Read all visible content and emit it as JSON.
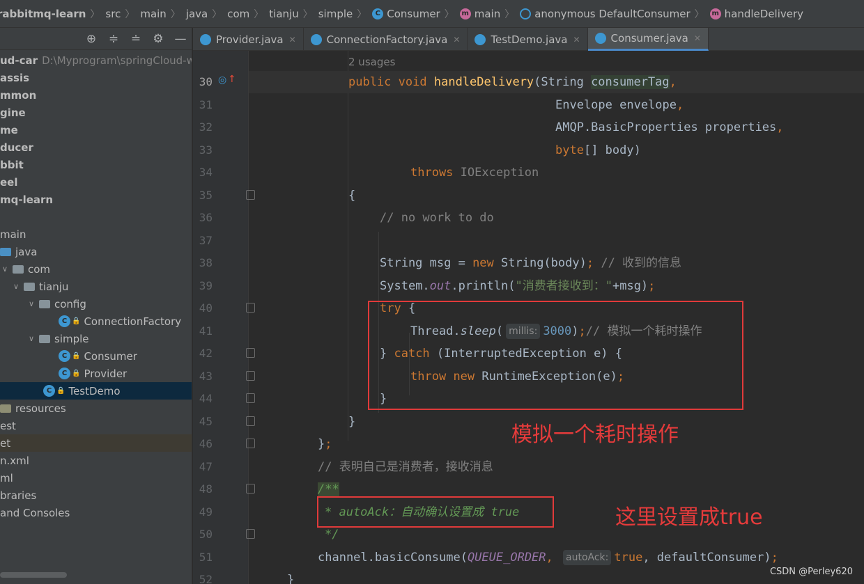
{
  "breadcrumb": {
    "items": [
      "rabbitmq-learn",
      "src",
      "main",
      "java",
      "com",
      "tianju",
      "simple",
      "Consumer",
      "main",
      "anonymous DefaultConsumer",
      "handleDelivery"
    ]
  },
  "tabs": [
    {
      "label": "Provider.java"
    },
    {
      "label": "ConnectionFactory.java"
    },
    {
      "label": "TestDemo.java"
    },
    {
      "label": "Consumer.java"
    }
  ],
  "tree": [
    {
      "label": "ud-car",
      "suffix": "D:\\Myprogram\\springCloud-w"
    },
    {
      "label": "assis"
    },
    {
      "label": "mmon"
    },
    {
      "label": "gine"
    },
    {
      "label": "me"
    },
    {
      "label": "ducer"
    },
    {
      "label": "bbit"
    },
    {
      "label": "eel"
    },
    {
      "label": "mq-learn"
    },
    {
      "label": ""
    },
    {
      "label": "main"
    },
    {
      "label": "java"
    },
    {
      "label": "com"
    },
    {
      "label": "tianju"
    },
    {
      "label": "config"
    },
    {
      "label": "ConnectionFactory"
    },
    {
      "label": "simple"
    },
    {
      "label": "Consumer"
    },
    {
      "label": "Provider"
    },
    {
      "label": "TestDemo"
    },
    {
      "label": "resources"
    },
    {
      "label": "est"
    },
    {
      "label": "et"
    },
    {
      "label": "n.xml"
    },
    {
      "label": "ml"
    },
    {
      "label": "braries"
    },
    {
      "label": "and Consoles"
    }
  ],
  "lines": [
    "30",
    "31",
    "32",
    "33",
    "34",
    "35",
    "36",
    "37",
    "38",
    "39",
    "40",
    "41",
    "42",
    "43",
    "44",
    "45",
    "46",
    "47",
    "48",
    "49",
    "50",
    "51",
    "52"
  ],
  "code": {
    "usages": "2 usages",
    "l30": [
      "public",
      "void",
      "handleDelivery",
      "(String ",
      "consumerTag",
      ","
    ],
    "l31": [
      "Envelope envelope",
      ","
    ],
    "l32": [
      "AMQP.BasicProperties properties",
      ","
    ],
    "l33": [
      "byte",
      "[] body)"
    ],
    "l34": [
      "throws",
      "IOException"
    ],
    "l35": "{",
    "l36": "// no work to do",
    "l38": [
      "String msg = ",
      "new",
      " String(body)",
      ";",
      " // 收到的信息"
    ],
    "l39": [
      "System.",
      "out",
      ".println(",
      "\"消费者接收到：\"",
      "+msg)",
      ";"
    ],
    "l40": [
      "try",
      " {"
    ],
    "l41": [
      "Thread.",
      "sleep",
      "(",
      "millis:",
      "3000",
      ")",
      ";",
      "// 模拟一个耗时操作"
    ],
    "l42": [
      "} ",
      "catch",
      " (InterruptedException e) {"
    ],
    "l43": [
      "throw",
      " ",
      "new",
      " RuntimeException(e)",
      ";"
    ],
    "l44": "}",
    "l45": "}",
    "l46": [
      "}",
      ";"
    ],
    "l47": "// 表明自己是消费者，接收消息",
    "l48": "/**",
    "l49": "* autoAck：自动确认设置成 true",
    "l50": "*/",
    "l51": [
      "channel.basicConsume(",
      "QUEUE_ORDER",
      ", ",
      "autoAck:",
      "true",
      ", defaultConsumer)",
      ";"
    ],
    "l52": "}"
  },
  "annotations": {
    "sleep_note": "模拟一个耗时操作",
    "true_note": "这里设置成true"
  },
  "watermark": "CSDN @Perley620",
  "icons": {
    "toolbar": [
      "locate-icon",
      "expand-all-icon",
      "collapse-all-icon",
      "settings-icon",
      "hide-icon"
    ],
    "class_color": "#3d97d1",
    "method_color": "#c6699a"
  },
  "colors": {
    "annotation_red": "#e53b3b",
    "keyword": "#cc7832",
    "method": "#ffc66d",
    "comment": "#808080",
    "doc": "#629755",
    "string": "#6a8759",
    "number": "#6897bb"
  }
}
